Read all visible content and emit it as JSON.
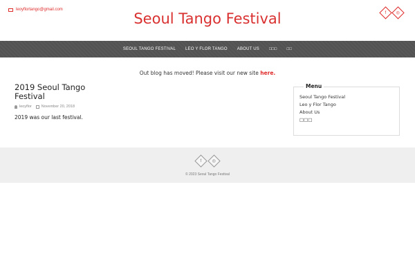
{
  "header": {
    "email": "leoyflortango@gmail.com",
    "site_title": "Seoul Tango Festival",
    "social": [
      {
        "icon": "facebook-icon",
        "glyph": "f"
      },
      {
        "icon": "instagram-icon",
        "glyph": "◎"
      }
    ]
  },
  "nav": {
    "items": [
      "SEOUL TANGO FESTIVAL",
      "LEO Y FLOR TANGO",
      "ABOUT US",
      "□□□",
      "□□"
    ]
  },
  "notice": {
    "text": "Out blog has moved! Please visit our new site",
    "link_text": "here."
  },
  "post": {
    "title": "2019 Seoul Tango Festival",
    "author": "leoyflor",
    "date": "November 20, 2018",
    "body": "2019 was our last festival."
  },
  "sidebar": {
    "widget_title": "Menu",
    "items": [
      "Seoul Tango Festival",
      "Leo y Flor Tango",
      "About Us",
      "□□□"
    ]
  },
  "footer": {
    "social": [
      {
        "icon": "facebook-icon",
        "glyph": "f"
      },
      {
        "icon": "instagram-icon",
        "glyph": "◎"
      }
    ],
    "copyright": "© 2023 Seoul Tango Festival"
  },
  "colors": {
    "accent": "#e02b2b",
    "nav_bg": "#525252",
    "footer_bg": "#efefef"
  }
}
